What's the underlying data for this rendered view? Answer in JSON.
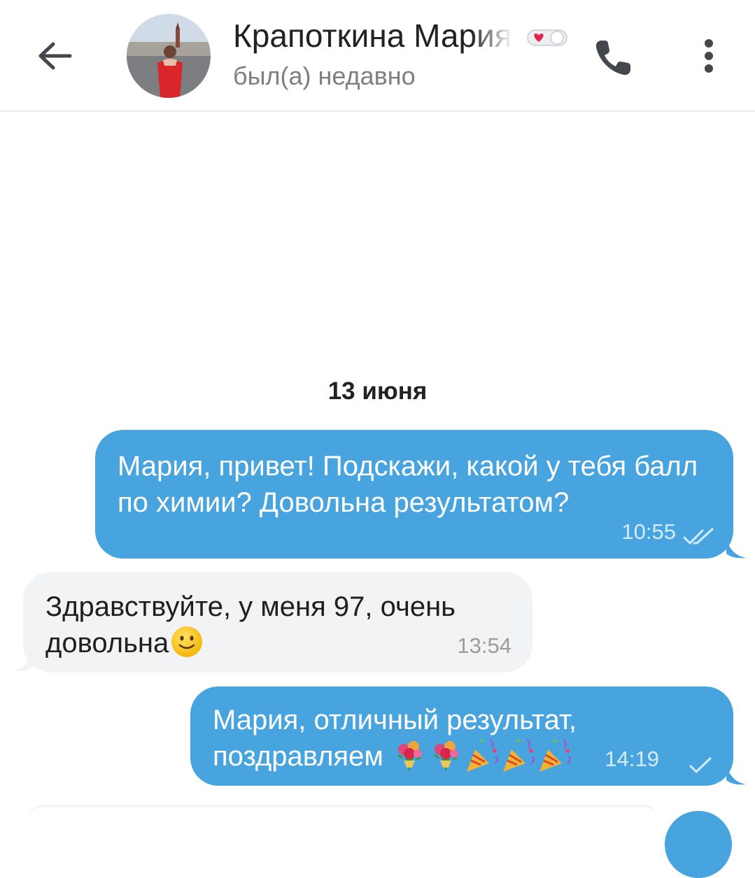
{
  "header": {
    "contact_name": "Крапоткина Мария",
    "status": "был(а) недавно",
    "icons": {
      "back": "arrow-left-icon",
      "avatar": "avatar",
      "badge": "heart-toggle-icon",
      "call": "phone-icon",
      "menu": "more-vertical-icon"
    }
  },
  "chat": {
    "date_separator": "13 июня",
    "messages": [
      {
        "direction": "outgoing",
        "text": "Мария, привет! Подскажи, какой у тебя балл по химии? Довольна результатом?",
        "time": "10:55",
        "status": "read"
      },
      {
        "direction": "incoming",
        "text": "Здравствуйте, у меня 97, очень довольна",
        "emoji": [
          "slightly-smiling-face"
        ],
        "time": "13:54"
      },
      {
        "direction": "outgoing",
        "text": "Мария,  отличный результат, поздравляем",
        "emoji": [
          "bouquet",
          "bouquet",
          "party-popper",
          "party-popper",
          "party-popper"
        ],
        "time": "14:19",
        "status": "sent"
      }
    ]
  },
  "colors": {
    "outgoing_bubble": "#48a4de",
    "incoming_bubble": "#f2f3f5",
    "accent": "#48a4de"
  }
}
